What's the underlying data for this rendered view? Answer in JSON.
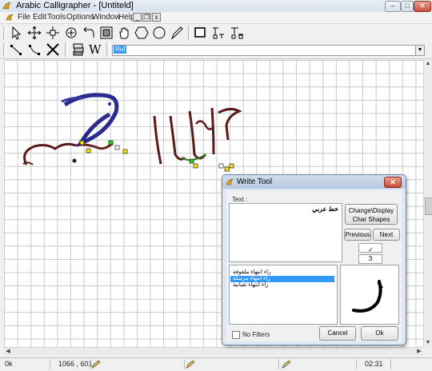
{
  "window": {
    "title": "Arabic Calligrapher - [Untiteld]",
    "minimize_glyph": "–",
    "maximize_glyph": "□",
    "close_glyph": "✕"
  },
  "menu": {
    "items": [
      "File",
      "Edit",
      "Tools",
      "Options",
      "Window",
      "Help"
    ],
    "mdi_minimize": "_",
    "mdi_restore": "❐",
    "mdi_close": "x"
  },
  "toolbar1": {
    "tools": [
      "pointer-icon",
      "move-icon",
      "node-edit-icon",
      "circle-target-icon",
      "rotate-icon",
      "frame-icon",
      "hand-icon",
      "hexagon-icon",
      "circle-icon",
      "pen-icon",
      "rectangle-icon",
      "align-icon",
      "distribute-icon"
    ]
  },
  "toolbar2": {
    "tools": [
      "line-icon",
      "curve-icon",
      "scissors-icon",
      "stack-icon",
      "write-tool-icon"
    ],
    "write_glyph": "W",
    "font_value": "Ruf"
  },
  "canvas": {
    "calligraphy": [
      "بكمر",
      "أهلا٤"
    ]
  },
  "statusbar": {
    "state": "0k",
    "coords": "1066 , 601",
    "time": "02:31"
  },
  "write_tool": {
    "title": "Write Tool",
    "close_glyph": "✕",
    "text_label": "Text :",
    "text_value": "خط عربي",
    "change_button_label": "Change\\Display Char Shapes",
    "previous_label": "Previous",
    "next_label": "Next",
    "char_value": "ر",
    "shape_count": "3",
    "shapes": [
      {
        "label": "راء انتهاء ملفوفة",
        "selected": false
      },
      {
        "label": "راء انتهاء مرسلة",
        "selected": true
      },
      {
        "label": "راء انتهاء ثعبانية",
        "selected": false
      }
    ],
    "no_filters_label": "No Filters",
    "cancel_label": "Cancel",
    "ok_label": "Ok"
  }
}
